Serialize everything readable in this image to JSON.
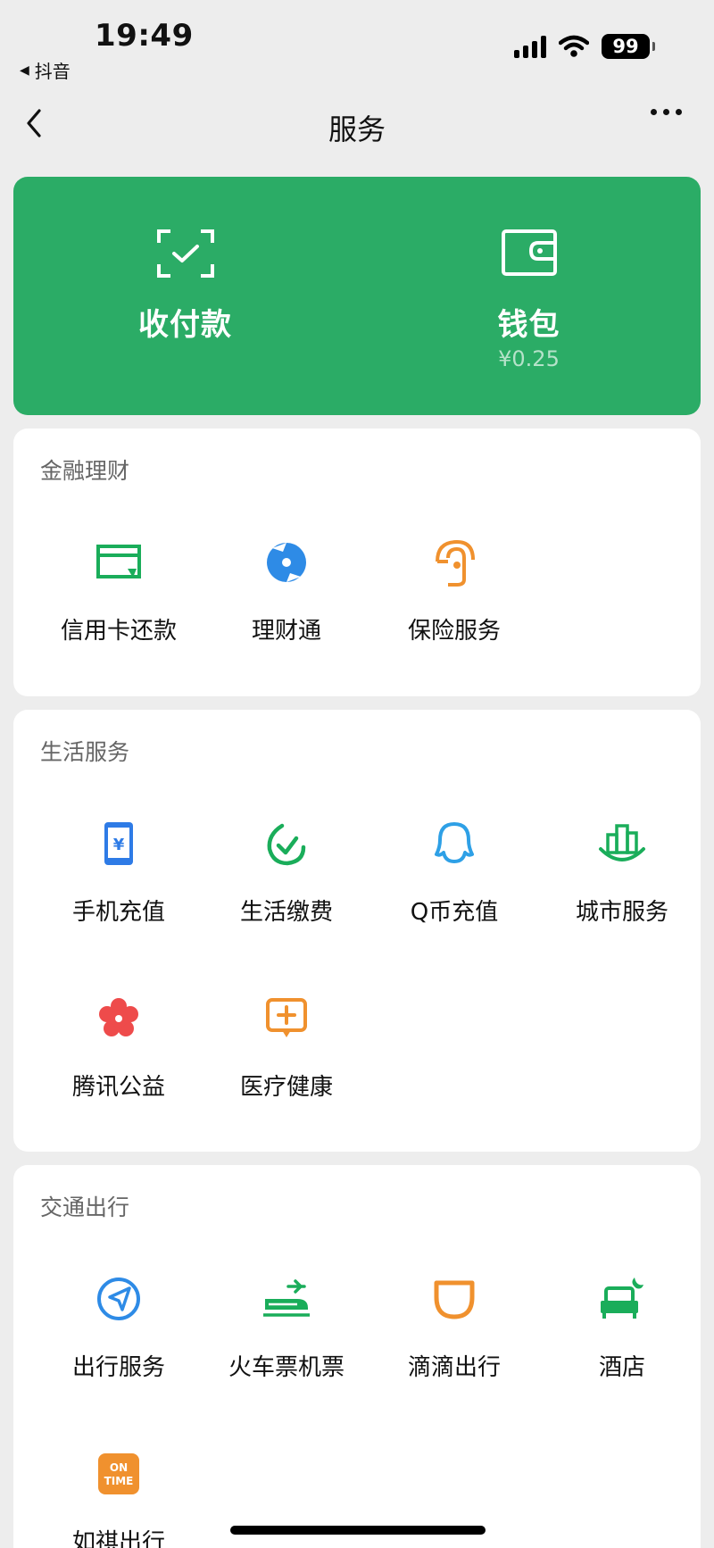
{
  "status_bar": {
    "time": "19:49",
    "back_app": "抖音",
    "battery": "99"
  },
  "nav": {
    "title": "服务",
    "back_icon": "chevron-left-icon",
    "more_icon": "more-dots-icon"
  },
  "wallet_card": {
    "color": "#2BAC66",
    "items": [
      {
        "label": "收付款",
        "icon": "scan-pay-icon"
      },
      {
        "label": "钱包",
        "icon": "wallet-icon",
        "balance": "¥0.25"
      }
    ]
  },
  "sections": [
    {
      "title": "金融理财",
      "items": [
        {
          "label": "信用卡还款",
          "icon": "credit-card-icon",
          "color": "#1AAD5A"
        },
        {
          "label": "理财通",
          "icon": "licaitong-icon",
          "color": "#2E8BE6"
        },
        {
          "label": "保险服务",
          "icon": "insurance-umbrella-icon",
          "color": "#F0912E"
        }
      ]
    },
    {
      "title": "生活服务",
      "items": [
        {
          "label": "手机充值",
          "icon": "phone-recharge-icon",
          "color": "#2E7BE6"
        },
        {
          "label": "生活缴费",
          "icon": "life-payment-icon",
          "color": "#1AAD5A"
        },
        {
          "label": "Q币充值",
          "icon": "qq-coin-icon",
          "color": "#2EA0E6"
        },
        {
          "label": "城市服务",
          "icon": "city-service-icon",
          "color": "#1AAD5A"
        },
        {
          "label": "腾讯公益",
          "icon": "tencent-charity-icon",
          "color": "#EE4B4B"
        },
        {
          "label": "医疗健康",
          "icon": "medical-health-icon",
          "color": "#F0912E"
        }
      ]
    },
    {
      "title": "交通出行",
      "items": [
        {
          "label": "出行服务",
          "icon": "travel-compass-icon",
          "color": "#2E8BE6"
        },
        {
          "label": "火车票机票",
          "icon": "train-plane-icon",
          "color": "#1AAD5A"
        },
        {
          "label": "滴滴出行",
          "icon": "didi-icon",
          "color": "#F0912E"
        },
        {
          "label": "酒店",
          "icon": "hotel-bed-icon",
          "color": "#1AAD5A"
        },
        {
          "label": "如祺出行",
          "icon": "ontime-icon",
          "color": "#F0912E",
          "icon_text": "ON TIME"
        }
      ]
    }
  ]
}
